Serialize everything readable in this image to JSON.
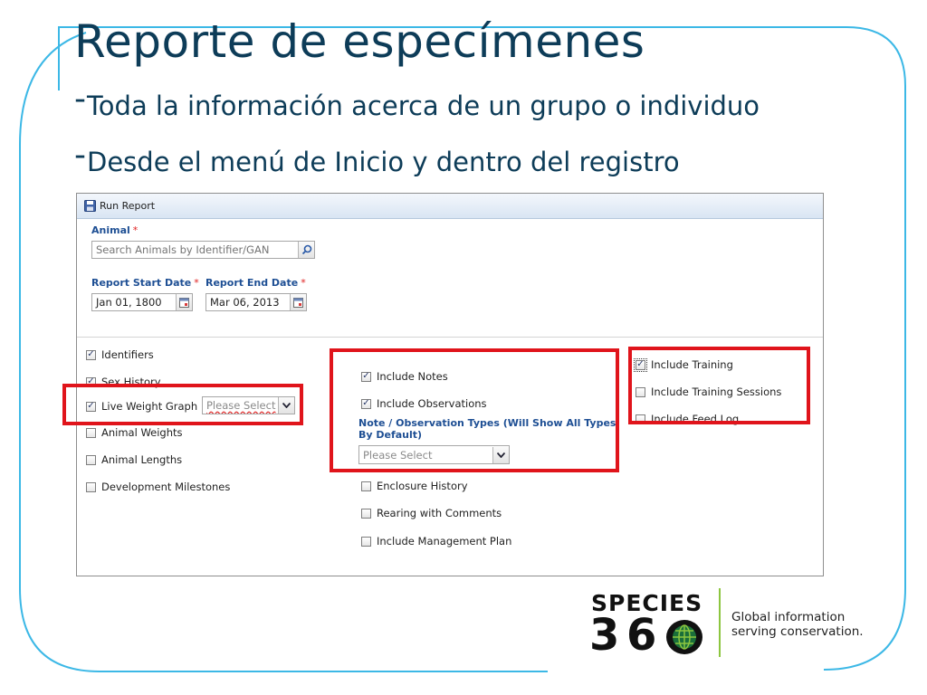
{
  "slide": {
    "title": "Reporte de especímenes",
    "bullets": [
      {
        "dash": "-",
        "text": "Toda la información acerca de un grupo o individuo"
      },
      {
        "dash": "-",
        "text": "Desde el menú de Inicio y dentro del registro"
      }
    ],
    "colors": {
      "title": "#0d3c58",
      "frame": "#3cb8e6",
      "highlight": "#e0141b"
    }
  },
  "app": {
    "header": {
      "label": "Run Report",
      "icon": "save-disk-icon"
    },
    "animal": {
      "label": "Animal",
      "required_mark": "*",
      "placeholder": "Search Animals by Identifier/GAN",
      "icon": "search-icon"
    },
    "start_date": {
      "label": "Report Start Date",
      "required_mark": "*",
      "value": "Jan 01, 1800",
      "icon": "calendar-icon"
    },
    "end_date": {
      "label": "Report End Date",
      "required_mark": "*",
      "value": "Mar 06, 2013",
      "icon": "calendar-icon"
    },
    "options": {
      "identifiers": {
        "label": "Identifiers",
        "checked": true
      },
      "sex_history": {
        "label": "Sex History",
        "checked": true
      },
      "live_weight_graph": {
        "label": "Live Weight Graph",
        "checked": true,
        "select_placeholder": "Please Select"
      },
      "animal_weights": {
        "label": "Animal Weights",
        "checked": false
      },
      "animal_lengths": {
        "label": "Animal Lengths",
        "checked": false
      },
      "development_milestones": {
        "label": "Development Milestones",
        "checked": false
      },
      "include_notes": {
        "label": "Include Notes",
        "checked": true
      },
      "include_observations": {
        "label": "Include Observations",
        "checked": true
      },
      "obs_types_label": "Note / Observation Types (Will Show All Types By Default)",
      "obs_types_placeholder": "Please Select",
      "enclosure_history": {
        "label": "Enclosure History",
        "checked": false
      },
      "rearing_with_comments": {
        "label": "Rearing with Comments",
        "checked": false
      },
      "include_management_plan": {
        "label": "Include Management Plan",
        "checked": false
      },
      "include_training": {
        "label": "Include Training",
        "checked": true
      },
      "include_training_sessions": {
        "label": "Include Training Sessions",
        "checked": false
      },
      "include_feed_log": {
        "label": "Include Feed Log",
        "checked": false
      }
    }
  },
  "logo": {
    "word": "SPECIES",
    "number_parts": [
      "3",
      "6",
      "0"
    ],
    "tagline_line1": "Global information",
    "tagline_line2": "serving conservation.",
    "accent": "#8cc63f",
    "globe_color": "#1a6f3a"
  }
}
